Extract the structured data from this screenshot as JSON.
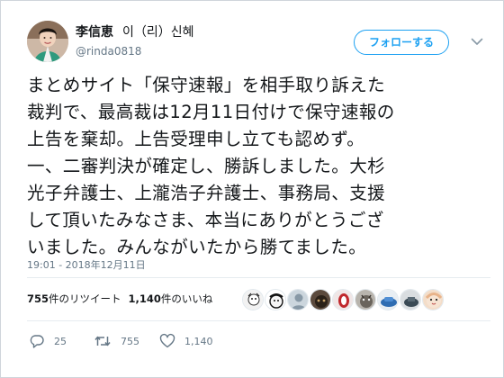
{
  "user": {
    "display_name": "李信恵",
    "alt_name": "이（리）신혜",
    "handle": "@rinda0818",
    "avatar_icon": "user-avatar"
  },
  "follow_button": {
    "label": "フォローする"
  },
  "more_button": {
    "icon": "chevron-down-icon"
  },
  "tweet": {
    "lines": [
      "まとめサイト「保守速報」を相手取り訴えた",
      "裁判で、最高裁は12月11日付けで保守速報の",
      "上告を棄却。上告受理申し立ても認めず。",
      "一、二審判決が確定し、勝訴しました。大杉",
      "光子弁護士、上瀧浩子弁護士、事務局、支援",
      "して頂いたみなさま、本当にありがとうござ",
      "いました。みんながいたから勝てました。"
    ],
    "timestamp": "19:01 - 2018年12月11日"
  },
  "stats": {
    "retweets_count": "755",
    "retweets_label": "件のリツイート",
    "likes_count": "1,140",
    "likes_label": "件のいいね"
  },
  "actions": {
    "reply_count": "25",
    "retweet_count": "755",
    "like_count": "1,140"
  },
  "colors": {
    "accent": "#1da1f2",
    "secondary_text": "#657786",
    "border": "#e6ecf0"
  }
}
